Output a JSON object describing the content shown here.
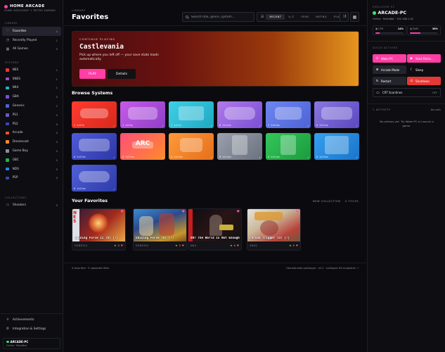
{
  "brand": {
    "title": "HOME ARCADE",
    "subtitle": "HOME ASSISTANT + RETRO GAMING"
  },
  "sidebar": {
    "library_label": "LIBRARY",
    "library": [
      {
        "label": "Favorites",
        "count": "4",
        "icon": "heart-icon",
        "active": true
      },
      {
        "label": "Recently Played",
        "count": "1",
        "icon": "clock-icon"
      },
      {
        "label": "All Games",
        "count": "5",
        "icon": "grid-icon"
      }
    ],
    "systems_label": "SYSTEMS",
    "systems": [
      {
        "label": "NES",
        "count": "1",
        "color": "#e53935"
      },
      {
        "label": "SNES",
        "count": "1",
        "color": "#9c4dcc"
      },
      {
        "label": "N64",
        "count": "1",
        "color": "#1fb3c9"
      },
      {
        "label": "GBA",
        "count": "0",
        "color": "#7a4fd6"
      },
      {
        "label": "Genesis",
        "count": "2",
        "color": "#4d63d6"
      },
      {
        "label": "PS1",
        "count": "0",
        "color": "#6b57c9"
      },
      {
        "label": "PS2",
        "count": "0",
        "color": "#3b46b8"
      },
      {
        "label": "Arcade",
        "count": "0",
        "color": "#f0552f"
      },
      {
        "label": "Dreamcast",
        "count": "0",
        "color": "#f28a2a"
      },
      {
        "label": "Game Boy",
        "count": "0",
        "color": "#8a8f9c"
      },
      {
        "label": "GBC",
        "count": "0",
        "color": "#22b24c"
      },
      {
        "label": "NDS",
        "count": "0",
        "color": "#1e88e5"
      },
      {
        "label": "PSP",
        "count": "0",
        "color": "#3949ab"
      }
    ],
    "collections_label": "COLLECTIONS",
    "collections": [
      {
        "label": "Shooters",
        "count": "0",
        "icon": "folder-icon"
      }
    ],
    "bottom": [
      {
        "label": "Achievements",
        "icon": "trophy-icon"
      },
      {
        "label": "Integration & Settings",
        "icon": "gear-icon"
      }
    ],
    "user": {
      "name": "ARCADE-PC",
      "status": "Online · RetroBat"
    }
  },
  "header": {
    "breadcrumb": "LIBRARY",
    "title": "Favorites",
    "search_placeholder": "Search title, genre, system...",
    "sort_options": [
      "RECENT",
      "A–Z",
      "YEAR",
      "RATING",
      "PLAYS"
    ],
    "sort_active": 0
  },
  "hero": {
    "tag": "CONTINUE PLAYING",
    "title": "Castlevania",
    "description": "Pick up where you left off — your save state loads automatically.",
    "play_label": "PLAY",
    "details_label": "Details"
  },
  "browse": {
    "title": "Browse Systems",
    "cards": [
      {
        "count": "1 title",
        "c1": "#ff3b30",
        "c2": "#d8281c",
        "shape": "nes"
      },
      {
        "count": "1 title",
        "c1": "#c65be8",
        "c2": "#8f3ec9",
        "shape": "snes"
      },
      {
        "count": "1 title",
        "c1": "#3fd0e6",
        "c2": "#1fa8c2",
        "shape": "n64"
      },
      {
        "count": "0 titles",
        "c1": "#b07ae8",
        "c2": "#7a4fd6",
        "shape": "gba"
      },
      {
        "count": "2 titles",
        "c1": "#6e86f0",
        "c2": "#4d63d6",
        "shape": "gen"
      },
      {
        "count": "0 titles",
        "c1": "#8a78e0",
        "c2": "#5a47c0",
        "shape": "ps1"
      },
      {
        "count": "0 titles",
        "c1": "#4f5bd6",
        "c2": "#2d37a8",
        "shape": "ps2"
      },
      {
        "count": "0 titles",
        "c1": "#ff4f7a",
        "c2": "#ff8a2a",
        "shape": "arc",
        "abbr": "ARC"
      },
      {
        "count": "0 titles",
        "c1": "#ff9a3a",
        "c2": "#e56f1c",
        "shape": "dc"
      },
      {
        "count": "0 titles",
        "c1": "#9aa0ae",
        "c2": "#6c717e",
        "shape": "gb"
      },
      {
        "count": "0 titles",
        "c1": "#33c75a",
        "c2": "#1c9a3e",
        "shape": "gbc"
      },
      {
        "count": "0 titles",
        "c1": "#35a0f0",
        "c2": "#1a74c9",
        "shape": "nds"
      },
      {
        "count": "0 titles",
        "c1": "#4f60d8",
        "c2": "#2e3aa8",
        "shape": "psp"
      }
    ]
  },
  "favorites": {
    "title": "Your Favorites",
    "new_collection_label": "NEW COLLECTION",
    "count_label": "4 TITLES",
    "items": [
      {
        "title": "Shining Force II (U) [!]",
        "system": "GENESIS",
        "rating": "3"
      },
      {
        "title": "Shining Force (U) [!]",
        "system": "GENESIS",
        "rating": "3"
      },
      {
        "title": "007 The World Is Not Enough",
        "system": "N64",
        "rating": "4"
      },
      {
        "title": "Chrono Trigger (U) [!]",
        "system": "SNES",
        "rating": "5"
      }
    ]
  },
  "footer": {
    "left": "4 favorited · 5 uploaded titles",
    "right": "HomeArcade prototype · v0.1 · configure HA endpoints →"
  },
  "right": {
    "emu_label": "EMULATOR PC",
    "emu_name": "ARCADE-PC",
    "emu_status": "Online · RetroBat · 192.168.1.42",
    "cpu_label": "CPU",
    "cpu_value": "14%",
    "cpu_fraction": 0.14,
    "ram_label": "RAM",
    "ram_value": "38%",
    "ram_fraction": 0.38,
    "quick_label": "QUICK ACTIONS",
    "actions": [
      {
        "label": "Wake PC",
        "icon": "power-icon",
        "color": "#ff3fa4"
      },
      {
        "label": "Start Retro...",
        "icon": "play-icon",
        "color": "#ff3fa4"
      },
      {
        "label": "Arcade Mode",
        "icon": "gamepad-icon",
        "color": "#24242c"
      },
      {
        "label": "Sleep",
        "icon": "moon-icon",
        "color": "#0d0d12"
      },
      {
        "label": "Restart",
        "icon": "restart-icon",
        "color": "#24242c"
      },
      {
        "label": "Shutdown",
        "icon": "shutdown-icon",
        "color": "#e53935"
      }
    ],
    "crt_label": "CRT Scanlines",
    "crt_state": "OFF",
    "activity_label": "ACTIVITY",
    "activity_right": "No calls",
    "activity_empty": "No actions yet. Try Wake PC or Launch a game."
  },
  "colors": {
    "accent": "#ff3fa4",
    "online": "#2ee86b",
    "danger": "#e53935"
  }
}
